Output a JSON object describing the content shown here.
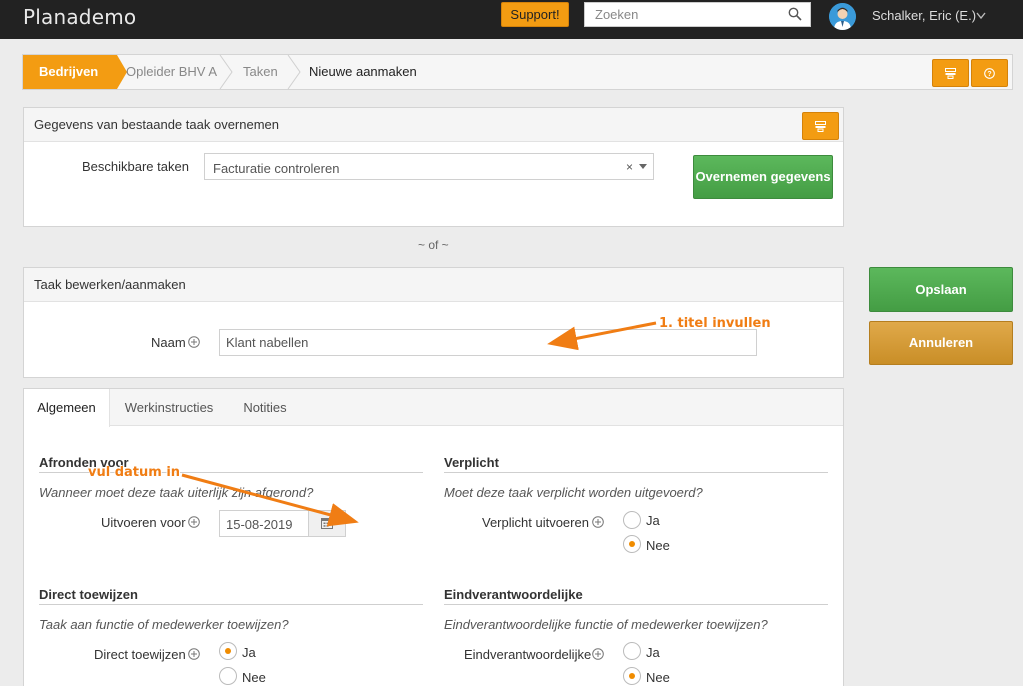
{
  "app": {
    "brand": "Planademo"
  },
  "topbar": {
    "support_label": "Support!",
    "search_placeholder": "Zoeken",
    "user_name": "Schalker, Eric (E.)"
  },
  "breadcrumb": {
    "items": [
      "Bedrijven",
      "Opleider BHV A",
      "Taken",
      "Nieuwe aanmaken"
    ]
  },
  "copy_panel": {
    "title": "Gegevens van bestaande taak overnemen",
    "field_label": "Beschikbare taken",
    "selected_task": "Facturatie controleren",
    "clear_symbol": "×",
    "submit_label": "Overnemen gegevens"
  },
  "separator": "~ of ~",
  "edit_panel": {
    "title": "Taak bewerken/aanmaken",
    "name_label": "Naam",
    "name_value": "Klant nabellen"
  },
  "actions": {
    "save_label": "Opslaan",
    "cancel_label": "Annuleren"
  },
  "tabs": [
    "Algemeen",
    "Werkinstructies",
    "Notities"
  ],
  "sections": {
    "afronden": {
      "title": "Afronden voor",
      "description": "Wanneer moet deze taak uiterlijk zijn afgerond?",
      "field_label": "Uitvoeren voor",
      "date_value": "15-08-2019"
    },
    "verplicht": {
      "title": "Verplicht",
      "description": "Moet deze taak verplicht worden uitgevoerd?",
      "field_label": "Verplicht uitvoeren",
      "options": [
        "Ja",
        "Nee"
      ],
      "selected": "Nee"
    },
    "direct": {
      "title": "Direct toewijzen",
      "description": "Taak aan functie of medewerker toewijzen?",
      "field_label": "Direct toewijzen",
      "options": [
        "Ja",
        "Nee"
      ],
      "selected": "Ja"
    },
    "eindverantwoordelijke": {
      "title": "Eindverantwoordelijke",
      "description": "Eindverantwoordelijke functie of medewerker toewijzen?",
      "field_label": "Eindverantwoordelijke",
      "options": [
        "Ja",
        "Nee"
      ],
      "selected": "Nee"
    }
  },
  "annotations": {
    "title_hint": "1. titel invullen",
    "date_hint": "vul datum in",
    "color": "#f07d14"
  },
  "colors": {
    "accent": "#f39c12",
    "success": "#5cb85c",
    "warning": "#c98e27",
    "topbar": "#222222"
  }
}
